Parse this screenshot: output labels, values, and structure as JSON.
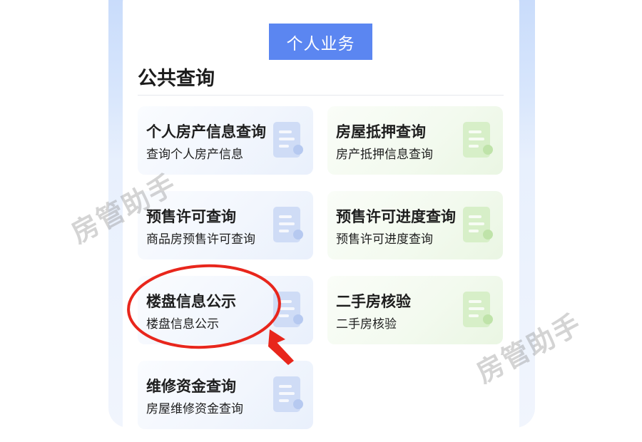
{
  "header": {
    "tab_label": "个人业务"
  },
  "section": {
    "title": "公共查询"
  },
  "cards": [
    {
      "title": "个人房产信息查询",
      "subtitle": "查询个人房产信息",
      "tone": "blue"
    },
    {
      "title": "房屋抵押查询",
      "subtitle": "房产抵押信息查询",
      "tone": "green"
    },
    {
      "title": "预售许可查询",
      "subtitle": "商品房预售许可查询",
      "tone": "blue"
    },
    {
      "title": "预售许可进度查询",
      "subtitle": "预售许可进度查询",
      "tone": "green"
    },
    {
      "title": "楼盘信息公示",
      "subtitle": "楼盘信息公示",
      "tone": "blue"
    },
    {
      "title": "二手房核验",
      "subtitle": "二手房核验",
      "tone": "green"
    },
    {
      "title": "维修资金查询",
      "subtitle": "房屋维修资金查询",
      "tone": "blue"
    }
  ],
  "watermark": {
    "text": "房管助手"
  },
  "colors": {
    "accent": "#5b86f1",
    "highlight": "#e8261c"
  },
  "icons": {
    "card_icon": "document-icon"
  }
}
